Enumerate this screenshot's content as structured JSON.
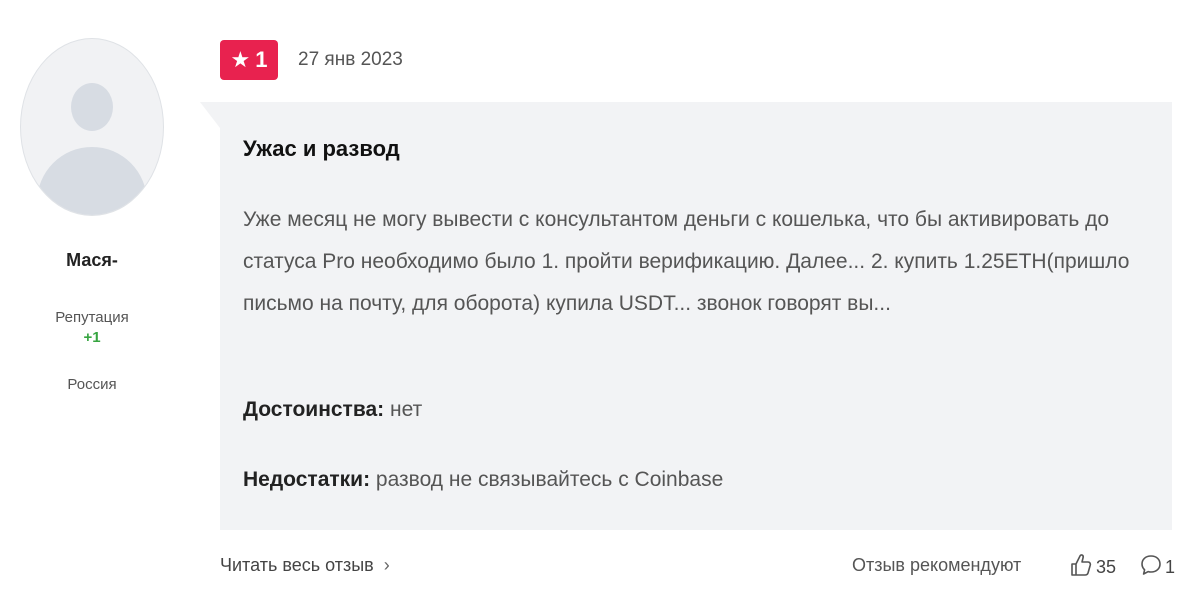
{
  "author": {
    "name": "Мася-",
    "reputation_label": "Репутация",
    "reputation_value": "+1",
    "country": "Россия"
  },
  "rating": {
    "value": "1",
    "color": "#e8224f"
  },
  "review": {
    "date": "27 янв 2023",
    "title": "Ужас и развод",
    "text": "Уже месяц не могу вывести с консультантом деньги с кошелька, что бы активировать до статуса Pro необходимо было 1. пройти верификацию. Далее... 2. купить 1.25ETH(пришло письмо на почту, для оборота) купила USDT... звонок говорят вы...",
    "pros_label": "Достоинства:",
    "pros_value": "нет",
    "cons_label": "Недостатки:",
    "cons_value": "развод не связывайтесь с Coinbase"
  },
  "footer": {
    "read_more": "Читать весь отзыв",
    "recommend_label": "Отзыв рекомендуют",
    "likes": "35",
    "comments": "1"
  },
  "icons": {
    "star": "star-icon",
    "thumb": "thumbs-up-icon",
    "comment": "comment-icon",
    "chevron": "chevron-right-icon"
  }
}
